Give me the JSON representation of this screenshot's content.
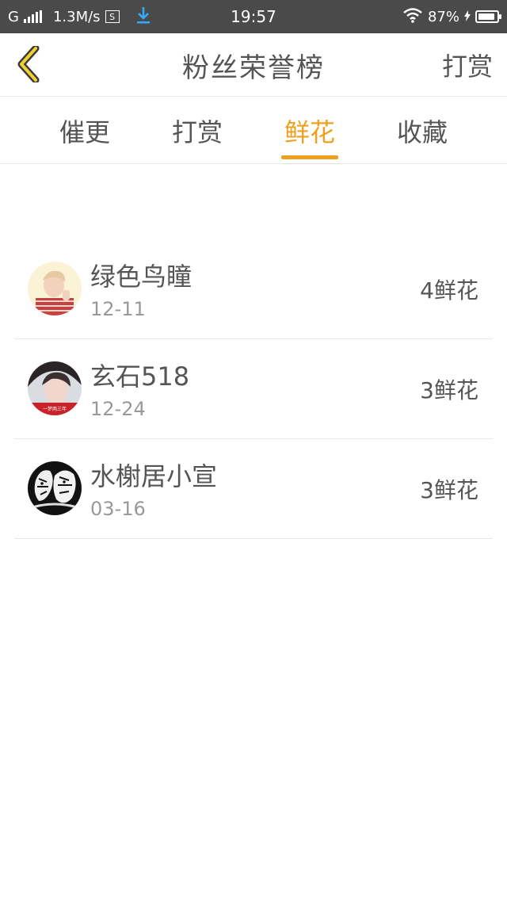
{
  "status_bar": {
    "network": "G",
    "speed": "1.3M/s",
    "sim_label": "S",
    "time": "19:57",
    "battery": "87%",
    "battery_level": 0.87
  },
  "header": {
    "title": "粉丝荣誉榜",
    "action_label": "打赏"
  },
  "tabs": [
    {
      "label": "催更",
      "active": false
    },
    {
      "label": "打赏",
      "active": false
    },
    {
      "label": "鲜花",
      "active": true
    },
    {
      "label": "收藏",
      "active": false
    }
  ],
  "fans": [
    {
      "name": "绿色鸟瞳",
      "date": "12-11",
      "count": "4鲜花"
    },
    {
      "name": "玄石518",
      "date": "12-24",
      "count": "3鲜花",
      "avatar_caption": "一梦两三年"
    },
    {
      "name": "水榭居小宣",
      "date": "03-16",
      "count": "3鲜花"
    }
  ],
  "colors": {
    "accent": "#f0a020",
    "text": "#555555",
    "subtext": "#999999",
    "status_bar": "#4a4a4a"
  }
}
